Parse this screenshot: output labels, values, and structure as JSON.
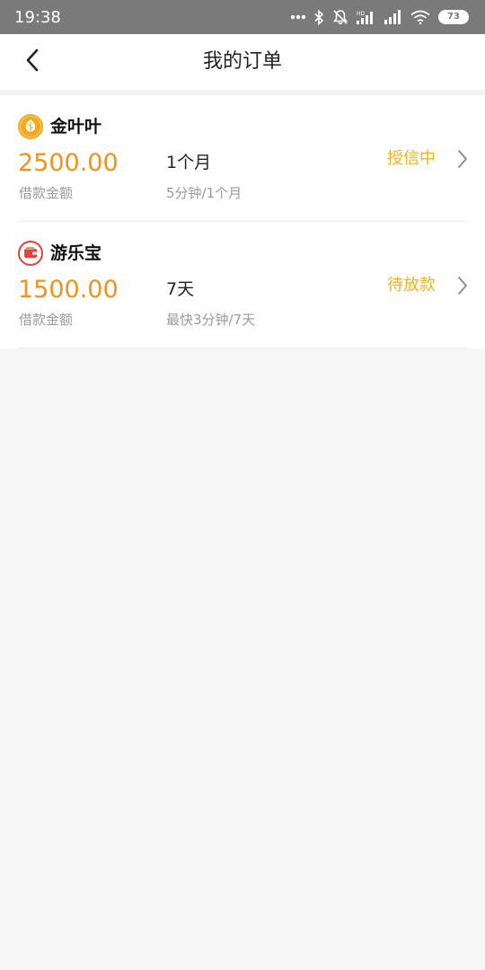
{
  "status_bar": {
    "time": "19:38",
    "battery": "73",
    "icons": [
      "more-dots-icon",
      "bluetooth-icon",
      "mute-icon",
      "hd-signal-icon",
      "signal-icon",
      "wifi-icon",
      "battery-icon"
    ]
  },
  "header": {
    "title": "我的订单",
    "back_icon": "chevron-left-icon"
  },
  "orders": [
    {
      "name": "金叶叶",
      "logo_icon": "gold-leaf-icon",
      "amount": "2500.00",
      "amount_label": "借款金额",
      "term": "1个月",
      "term_sub": "5分钟/1个月",
      "status": "授信中"
    },
    {
      "name": "游乐宝",
      "logo_icon": "wallet-icon",
      "amount": "1500.00",
      "amount_label": "借款金额",
      "term": "7天",
      "term_sub": "最快3分钟/7天",
      "status": "待放款"
    }
  ],
  "colors": {
    "amount": "#f0921c",
    "status": "#f0b31c",
    "status_bar_bg": "#7a7a7a",
    "page_bg": "#f6f6f6"
  }
}
